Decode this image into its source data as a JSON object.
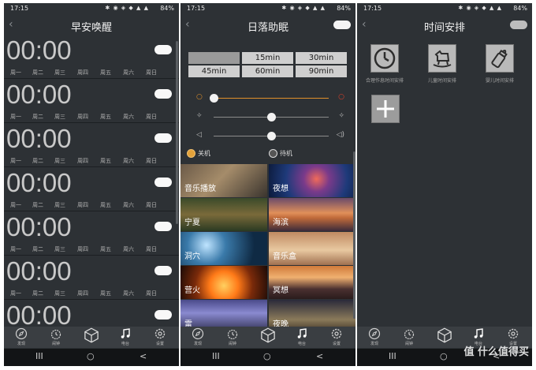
{
  "status": {
    "time": "17:15",
    "icons": "✱ ◉ ◈ ◆ ▲ ▲",
    "battery": "84%"
  },
  "panel1": {
    "title": "早安唤醒",
    "alarms": [
      {
        "time": "00:00"
      },
      {
        "time": "00:00"
      },
      {
        "time": "00:00"
      },
      {
        "time": "00:00"
      },
      {
        "time": "00:00"
      },
      {
        "time": "00:00"
      },
      {
        "time": "00:00"
      }
    ],
    "days": [
      "周一",
      "周二",
      "周三",
      "周四",
      "周五",
      "周六",
      "周日"
    ]
  },
  "panel2": {
    "title": "日落助眠",
    "presets": [
      "",
      "15min",
      "30min",
      "45min",
      "60min",
      "90min"
    ],
    "selected_preset": 0,
    "slider_levels": [
      0.0,
      0.5,
      0.5
    ],
    "radio_on": "关机",
    "radio_standby": "待机",
    "radio_selected": "关机",
    "tiles": [
      {
        "label": "音乐播放"
      },
      {
        "label": "夜想"
      },
      {
        "label": "宁夏"
      },
      {
        "label": "海滨"
      },
      {
        "label": "洞穴"
      },
      {
        "label": "音乐盒"
      },
      {
        "label": "营火"
      },
      {
        "label": "冥想"
      },
      {
        "label": "雷"
      },
      {
        "label": "夜晚"
      }
    ]
  },
  "panel3": {
    "title": "时间安排",
    "items": [
      {
        "label": "合理作息时间安排",
        "icon": "clock-icon"
      },
      {
        "label": "儿童时间安排",
        "icon": "rocking-horse-icon"
      },
      {
        "label": "婴儿时间安排",
        "icon": "baby-bottle-icon"
      }
    ],
    "add_icon": "plus-icon"
  },
  "nav": {
    "labels": [
      "发现",
      "闹钟",
      "",
      "电台",
      "设置"
    ],
    "icons": [
      "compass-icon",
      "alarm-icon",
      "cube-icon",
      "music-note-icon",
      "gear-icon"
    ],
    "active_index": 3
  },
  "system_nav": {
    "recent": "III",
    "home": "○",
    "back": "<"
  },
  "watermark": "值 什么值得买",
  "colors": {
    "panel_bg": "#2d3135",
    "accent_orange": "#e3a23a",
    "toggle_on": "#f4f4f4"
  }
}
